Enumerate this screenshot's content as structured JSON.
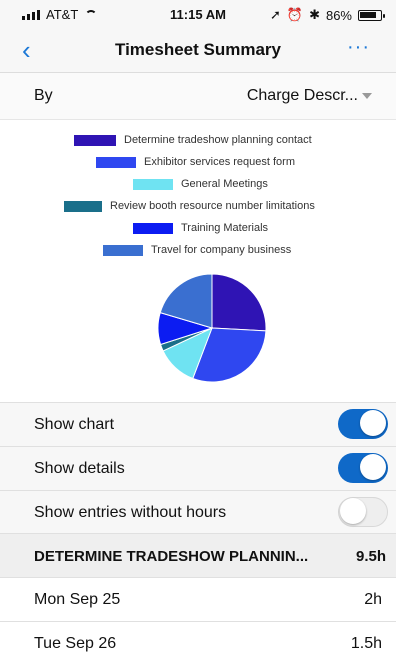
{
  "status": {
    "carrier": "AT&T",
    "time": "11:15 AM",
    "battery": "86%"
  },
  "nav": {
    "title": "Timesheet Summary",
    "back_icon": "‹",
    "more_icon": "···"
  },
  "by": {
    "label": "By",
    "value": "Charge Descr..."
  },
  "chart_data": {
    "type": "pie",
    "categories": [
      "Determine tradeshow planning contact",
      "Exhibitor services request form",
      "General Meetings",
      "Review booth resource number limitations",
      "Training Materials",
      "Travel for company business"
    ],
    "values": [
      9.5,
      11,
      4.5,
      0.75,
      3.5,
      7.5
    ],
    "colors": [
      "#2f14b4",
      "#2f47f0",
      "#6fe3f2",
      "#1a6f8a",
      "#0c1cf2",
      "#3a6fd0"
    ]
  },
  "toggles": [
    {
      "label": "Show chart",
      "on": true
    },
    {
      "label": "Show details",
      "on": true
    },
    {
      "label": "Show entries without hours",
      "on": false
    }
  ],
  "section": {
    "label": "DETERMINE TRADESHOW PLANNIN...",
    "value": "9.5h"
  },
  "entries": [
    {
      "label": "Mon Sep 25",
      "value": "2h"
    },
    {
      "label": "Tue Sep 26",
      "value": "1.5h"
    }
  ]
}
